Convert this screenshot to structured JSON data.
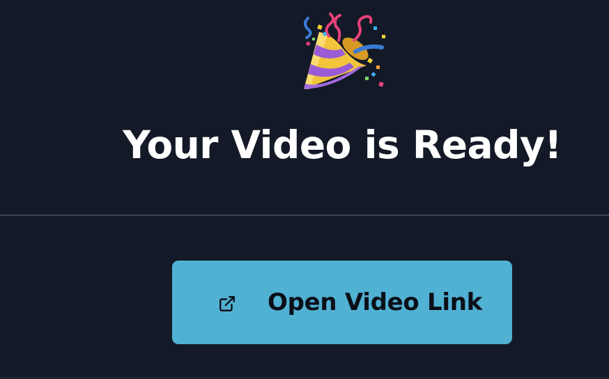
{
  "header": {
    "icon": "party-popper-icon",
    "title": "Your Video is Ready!"
  },
  "action": {
    "icon": "external-link-icon",
    "label": "Open Video Link",
    "background": "#51b1d2"
  },
  "theme": {
    "page_background": "#131927",
    "divider": "#3a4252",
    "title_color": "#ffffff",
    "button_text": "#0b0f18"
  }
}
